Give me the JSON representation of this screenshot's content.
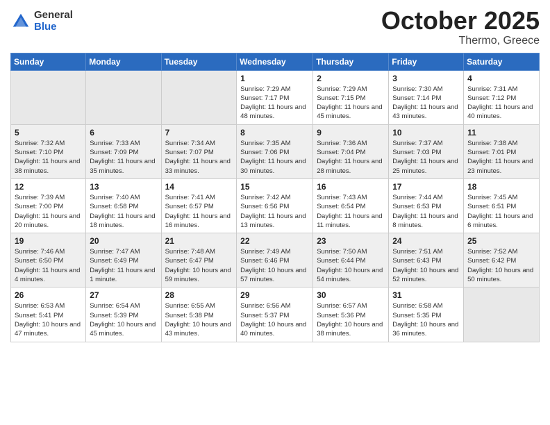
{
  "logo": {
    "general": "General",
    "blue": "Blue"
  },
  "header": {
    "month": "October 2025",
    "location": "Thermo, Greece"
  },
  "weekdays": [
    "Sunday",
    "Monday",
    "Tuesday",
    "Wednesday",
    "Thursday",
    "Friday",
    "Saturday"
  ],
  "weeks": [
    [
      {
        "day": "",
        "sunrise": "",
        "sunset": "",
        "daylight": ""
      },
      {
        "day": "",
        "sunrise": "",
        "sunset": "",
        "daylight": ""
      },
      {
        "day": "",
        "sunrise": "",
        "sunset": "",
        "daylight": ""
      },
      {
        "day": "1",
        "sunrise": "Sunrise: 7:29 AM",
        "sunset": "Sunset: 7:17 PM",
        "daylight": "Daylight: 11 hours and 48 minutes."
      },
      {
        "day": "2",
        "sunrise": "Sunrise: 7:29 AM",
        "sunset": "Sunset: 7:15 PM",
        "daylight": "Daylight: 11 hours and 45 minutes."
      },
      {
        "day": "3",
        "sunrise": "Sunrise: 7:30 AM",
        "sunset": "Sunset: 7:14 PM",
        "daylight": "Daylight: 11 hours and 43 minutes."
      },
      {
        "day": "4",
        "sunrise": "Sunrise: 7:31 AM",
        "sunset": "Sunset: 7:12 PM",
        "daylight": "Daylight: 11 hours and 40 minutes."
      }
    ],
    [
      {
        "day": "5",
        "sunrise": "Sunrise: 7:32 AM",
        "sunset": "Sunset: 7:10 PM",
        "daylight": "Daylight: 11 hours and 38 minutes."
      },
      {
        "day": "6",
        "sunrise": "Sunrise: 7:33 AM",
        "sunset": "Sunset: 7:09 PM",
        "daylight": "Daylight: 11 hours and 35 minutes."
      },
      {
        "day": "7",
        "sunrise": "Sunrise: 7:34 AM",
        "sunset": "Sunset: 7:07 PM",
        "daylight": "Daylight: 11 hours and 33 minutes."
      },
      {
        "day": "8",
        "sunrise": "Sunrise: 7:35 AM",
        "sunset": "Sunset: 7:06 PM",
        "daylight": "Daylight: 11 hours and 30 minutes."
      },
      {
        "day": "9",
        "sunrise": "Sunrise: 7:36 AM",
        "sunset": "Sunset: 7:04 PM",
        "daylight": "Daylight: 11 hours and 28 minutes."
      },
      {
        "day": "10",
        "sunrise": "Sunrise: 7:37 AM",
        "sunset": "Sunset: 7:03 PM",
        "daylight": "Daylight: 11 hours and 25 minutes."
      },
      {
        "day": "11",
        "sunrise": "Sunrise: 7:38 AM",
        "sunset": "Sunset: 7:01 PM",
        "daylight": "Daylight: 11 hours and 23 minutes."
      }
    ],
    [
      {
        "day": "12",
        "sunrise": "Sunrise: 7:39 AM",
        "sunset": "Sunset: 7:00 PM",
        "daylight": "Daylight: 11 hours and 20 minutes."
      },
      {
        "day": "13",
        "sunrise": "Sunrise: 7:40 AM",
        "sunset": "Sunset: 6:58 PM",
        "daylight": "Daylight: 11 hours and 18 minutes."
      },
      {
        "day": "14",
        "sunrise": "Sunrise: 7:41 AM",
        "sunset": "Sunset: 6:57 PM",
        "daylight": "Daylight: 11 hours and 16 minutes."
      },
      {
        "day": "15",
        "sunrise": "Sunrise: 7:42 AM",
        "sunset": "Sunset: 6:56 PM",
        "daylight": "Daylight: 11 hours and 13 minutes."
      },
      {
        "day": "16",
        "sunrise": "Sunrise: 7:43 AM",
        "sunset": "Sunset: 6:54 PM",
        "daylight": "Daylight: 11 hours and 11 minutes."
      },
      {
        "day": "17",
        "sunrise": "Sunrise: 7:44 AM",
        "sunset": "Sunset: 6:53 PM",
        "daylight": "Daylight: 11 hours and 8 minutes."
      },
      {
        "day": "18",
        "sunrise": "Sunrise: 7:45 AM",
        "sunset": "Sunset: 6:51 PM",
        "daylight": "Daylight: 11 hours and 6 minutes."
      }
    ],
    [
      {
        "day": "19",
        "sunrise": "Sunrise: 7:46 AM",
        "sunset": "Sunset: 6:50 PM",
        "daylight": "Daylight: 11 hours and 4 minutes."
      },
      {
        "day": "20",
        "sunrise": "Sunrise: 7:47 AM",
        "sunset": "Sunset: 6:49 PM",
        "daylight": "Daylight: 11 hours and 1 minute."
      },
      {
        "day": "21",
        "sunrise": "Sunrise: 7:48 AM",
        "sunset": "Sunset: 6:47 PM",
        "daylight": "Daylight: 10 hours and 59 minutes."
      },
      {
        "day": "22",
        "sunrise": "Sunrise: 7:49 AM",
        "sunset": "Sunset: 6:46 PM",
        "daylight": "Daylight: 10 hours and 57 minutes."
      },
      {
        "day": "23",
        "sunrise": "Sunrise: 7:50 AM",
        "sunset": "Sunset: 6:44 PM",
        "daylight": "Daylight: 10 hours and 54 minutes."
      },
      {
        "day": "24",
        "sunrise": "Sunrise: 7:51 AM",
        "sunset": "Sunset: 6:43 PM",
        "daylight": "Daylight: 10 hours and 52 minutes."
      },
      {
        "day": "25",
        "sunrise": "Sunrise: 7:52 AM",
        "sunset": "Sunset: 6:42 PM",
        "daylight": "Daylight: 10 hours and 50 minutes."
      }
    ],
    [
      {
        "day": "26",
        "sunrise": "Sunrise: 6:53 AM",
        "sunset": "Sunset: 5:41 PM",
        "daylight": "Daylight: 10 hours and 47 minutes."
      },
      {
        "day": "27",
        "sunrise": "Sunrise: 6:54 AM",
        "sunset": "Sunset: 5:39 PM",
        "daylight": "Daylight: 10 hours and 45 minutes."
      },
      {
        "day": "28",
        "sunrise": "Sunrise: 6:55 AM",
        "sunset": "Sunset: 5:38 PM",
        "daylight": "Daylight: 10 hours and 43 minutes."
      },
      {
        "day": "29",
        "sunrise": "Sunrise: 6:56 AM",
        "sunset": "Sunset: 5:37 PM",
        "daylight": "Daylight: 10 hours and 40 minutes."
      },
      {
        "day": "30",
        "sunrise": "Sunrise: 6:57 AM",
        "sunset": "Sunset: 5:36 PM",
        "daylight": "Daylight: 10 hours and 38 minutes."
      },
      {
        "day": "31",
        "sunrise": "Sunrise: 6:58 AM",
        "sunset": "Sunset: 5:35 PM",
        "daylight": "Daylight: 10 hours and 36 minutes."
      },
      {
        "day": "",
        "sunrise": "",
        "sunset": "",
        "daylight": ""
      }
    ]
  ]
}
